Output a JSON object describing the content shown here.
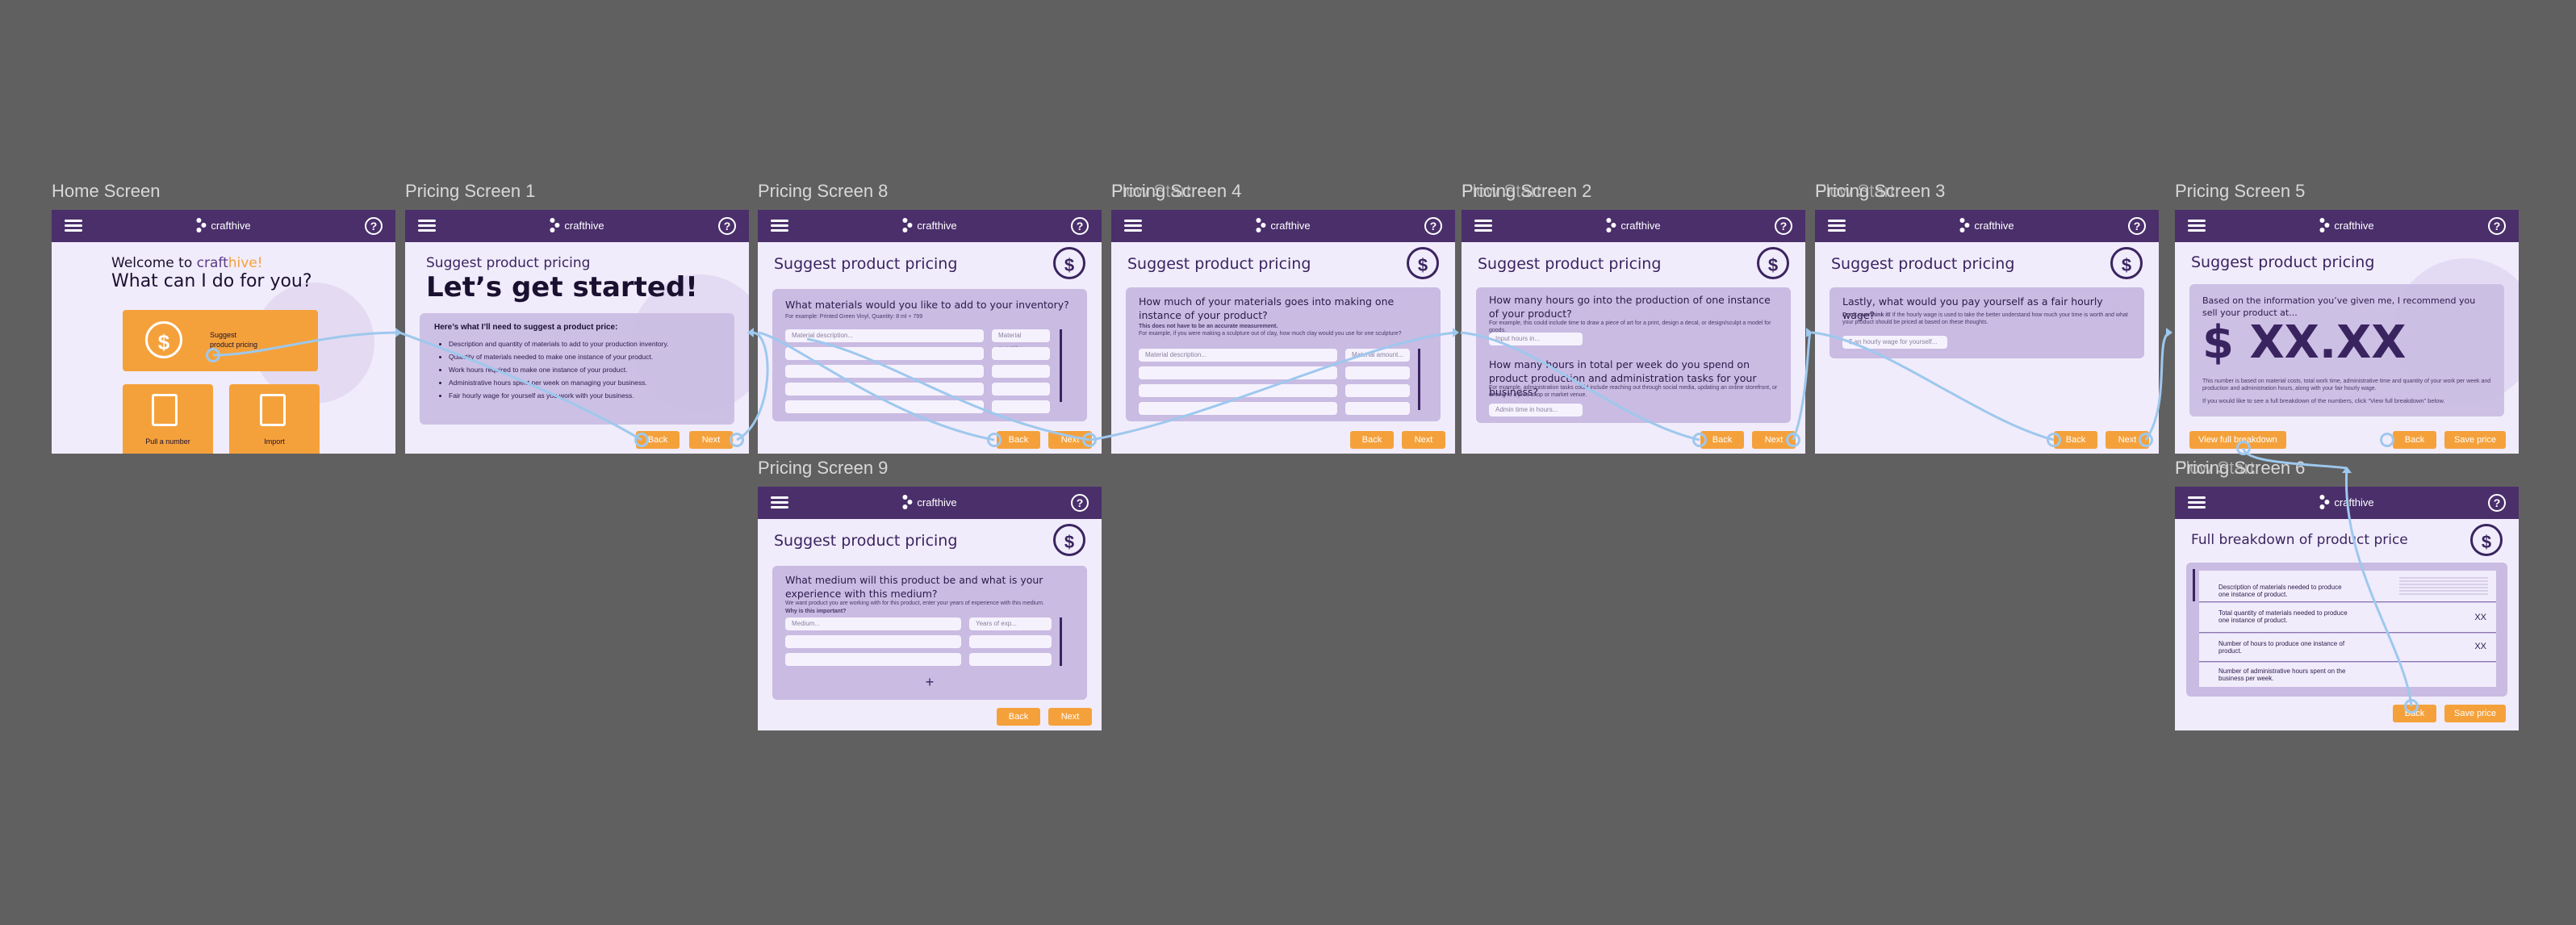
{
  "frames": {
    "home": {
      "label": "Home Screen",
      "brand": "crafthive",
      "welcome_prefix": "Welcome to ",
      "welcome_brand_a": "craft",
      "welcome_brand_b": "hive!",
      "headline": "What can I do for you?",
      "tiles": [
        {
          "label_line1": "Suggest",
          "label_line2": "product pricing",
          "icon": "dollar-icon"
        },
        {
          "label": "Pull a number",
          "icon": "document-search-icon"
        },
        {
          "label": "Import",
          "icon": "import-document-icon"
        }
      ]
    },
    "p1": {
      "label": "Pricing Screen 1",
      "title": "Suggest product pricing",
      "headline": "Let’s get started!",
      "intro": "Here’s what I’ll need to suggest a product price:",
      "items": [
        "Description and quantity of materials to add to your production inventory.",
        "Quantity of materials needed to make one instance of your product.",
        "Work hours required to make one instance of your product.",
        "Administrative hours spent per week on managing your business.",
        "Fair hourly wage for yourself as you work with your business."
      ],
      "back": "Back",
      "next": "Next"
    },
    "p8": {
      "label": "Pricing Screen 8",
      "title": "Suggest product pricing",
      "question": "What materials would you like to add to your inventory?",
      "hint": "For example: Printed Green Vinyl, Quantity: 8 ml + 799",
      "ph_desc": "Material description...",
      "ph_qty": "Material quantity...",
      "back": "Back",
      "next": "Next"
    },
    "p9": {
      "label": "Pricing Screen 9",
      "title": "Suggest product pricing",
      "question": "What medium will this product be and what is your experience with this medium?",
      "hint": "We want product you are working with for this product, enter your years of experience with this medium.",
      "hint2": "Why is this important?",
      "ph_medium": "Medium...",
      "ph_years": "Years of exp...",
      "plus": "+",
      "back": "Back",
      "next": "Next"
    },
    "p4": {
      "label": "Pricing Screen 4",
      "label_overlay": "Flow Start",
      "title": "Suggest product pricing",
      "question": "How much of your materials goes into making one instance of your product?",
      "hint_bold": "This does not have to be an accurate measurement.",
      "hint": "For example, if you were making a sculpture out of clay, how much clay would you use for one sculpture?",
      "ph_desc": "Material description...",
      "ph_qty": "Material amount...",
      "back": "Back",
      "next": "Next"
    },
    "p2": {
      "label": "Pricing Screen 2",
      "label_overlay": "Flow Start",
      "title": "Suggest product pricing",
      "question1": "How many hours go into the production of one instance of your product?",
      "hint1": "For example, this could include time to draw a piece of art for a print, design a decal, or design/sculpt a model for goods.",
      "ph1": "Input hours in...",
      "question2": "How many hours in total per week do you spend on product production and administration tasks for your business?",
      "hint2": "For example, administration tasks could include reaching out through social media, updating an online storefront, or driving to a print shop or market venue.",
      "ph2": "Admin time in hours...",
      "back": "Back",
      "next": "Next"
    },
    "p3": {
      "label": "Pricing Screen 3",
      "label_overlay": "Flow Start",
      "title": "Suggest product pricing",
      "question": "Lastly, what would you pay yourself as a fair hourly wage?",
      "hint_bold": "Don’t overthink it!",
      "hint": "If the hourly wage is used to take the better understand how much your time is worth and what your product should be priced at based on these thoughts.",
      "ph": "$ an hourly wage for yourself...",
      "back": "Back",
      "next": "Next"
    },
    "p5": {
      "label": "Pricing Screen 5",
      "title": "Suggest product pricing",
      "intro": "Based on the information you’ve given me, I recommend you sell your product at...",
      "price": "$ XX.XX",
      "note": "This number is based on material costs, total work time, administrative time and quantity of your work per week and production and administration hours, along with your fair hourly wage.",
      "note2": "If you would like to see a full breakdown of the numbers, click “View full breakdown” below.",
      "view_breakdown": "View full breakdown",
      "back": "Back",
      "save": "Save price"
    },
    "p6": {
      "label": "Pricing Screen 6",
      "label_overlay": "Flow Start",
      "title": "Full breakdown of product price",
      "rows": [
        {
          "label": "Description of materials needed to produce one instance of product.",
          "value": ""
        },
        {
          "label": "Total quantity of materials needed to produce one instance of product.",
          "value": "XX"
        },
        {
          "label": "Number of hours to produce one instance of product.",
          "value": "XX"
        },
        {
          "label": "Number of administrative hours spent on the business per week.",
          "value": ""
        }
      ],
      "back": "Back",
      "save": "Save price"
    }
  },
  "colors": {
    "canvas": "#606060",
    "header": "#4a2f6b",
    "accent": "#f5a13b",
    "card": "#c9bbe2",
    "screen_bg": "#f1ecfb",
    "connector": "#9ec8ee"
  }
}
